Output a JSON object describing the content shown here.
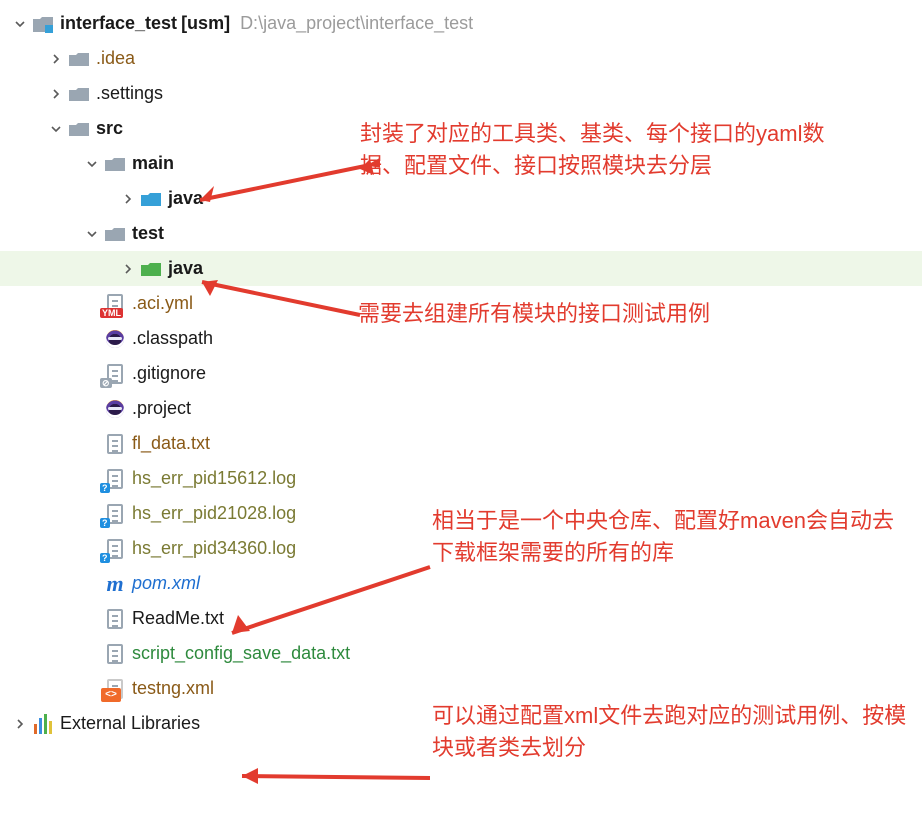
{
  "root": {
    "name": "interface_test",
    "suffix": "[usm]",
    "path": "D:\\java_project\\interface_test"
  },
  "tree": {
    "idea": ".idea",
    "settings": ".settings",
    "src": "src",
    "main": "main",
    "main_java": "java",
    "test": "test",
    "test_java": "java",
    "aci_yml": ".aci.yml",
    "classpath": ".classpath",
    "gitignore": ".gitignore",
    "project": ".project",
    "fl_data": "fl_data.txt",
    "hs1": "hs_err_pid15612.log",
    "hs2": "hs_err_pid21028.log",
    "hs3": "hs_err_pid34360.log",
    "pom": "pom.xml",
    "readme": "ReadMe.txt",
    "script_cfg": "script_config_save_data.txt",
    "testng": "testng.xml"
  },
  "ext_lib": "External Libraries",
  "annotations": {
    "a1": "封装了对应的工具类、基类、每个接口的yaml数据、配置文件、接口按照模块去分层",
    "a2": "需要去组建所有模块的接口测试用例",
    "a3": "相当于是一个中央仓库、配置好maven会自动去下载框架需要的所有的库",
    "a4": "可以通过配置xml文件去跑对应的测试用例、按模块或者类去划分"
  },
  "icons": {
    "folder": "folder-icon",
    "folder_open": "folder-open-icon",
    "module": "module-folder-icon",
    "java_src": "java-source-folder-icon",
    "java_test": "java-test-folder-icon",
    "file": "file-icon",
    "yml": "yml-file-icon",
    "eclipse": "eclipse-file-icon",
    "maven": "maven-file-icon",
    "xml": "xml-file-icon",
    "libs": "external-libraries-icon"
  }
}
